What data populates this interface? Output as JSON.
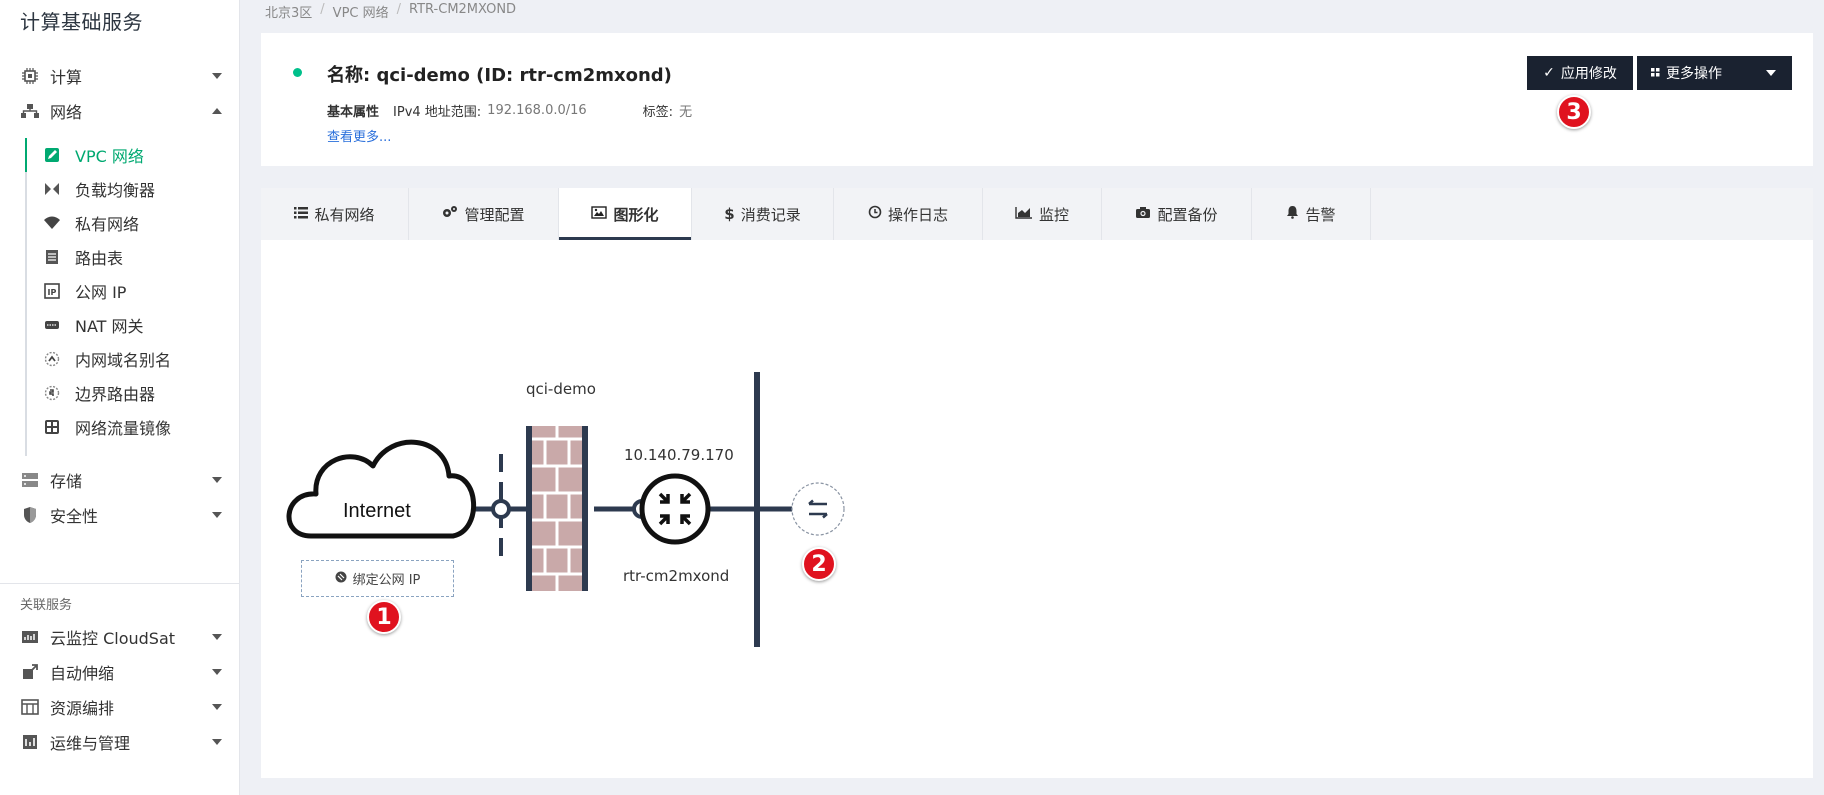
{
  "sidebar": {
    "title": "计算基础服务",
    "groups": [
      {
        "label": "计算",
        "icon": "chip-icon"
      },
      {
        "label": "网络",
        "icon": "network-icon"
      }
    ],
    "network_items": [
      {
        "label": "VPC 网络",
        "icon": "vpc-icon",
        "active": true
      },
      {
        "label": "负载均衡器",
        "icon": "load-balancer-icon"
      },
      {
        "label": "私有网络",
        "icon": "wifi-icon"
      },
      {
        "label": "路由表",
        "icon": "route-table-icon"
      },
      {
        "label": "公网 IP",
        "icon": "public-ip-icon"
      },
      {
        "label": "NAT 网关",
        "icon": "nat-gateway-icon"
      },
      {
        "label": "内网域名别名",
        "icon": "dns-alias-icon"
      },
      {
        "label": "边界路由器",
        "icon": "border-router-icon"
      },
      {
        "label": "网络流量镜像",
        "icon": "traffic-mirror-icon"
      }
    ],
    "other_groups": [
      {
        "label": "存储",
        "icon": "storage-icon"
      },
      {
        "label": "安全性",
        "icon": "shield-icon"
      }
    ],
    "related_title": "关联服务",
    "related": [
      {
        "label": "云监控 CloudSat",
        "icon": "monitor-icon"
      },
      {
        "label": "自动伸缩",
        "icon": "autoscale-icon"
      },
      {
        "label": "资源编排",
        "icon": "orchestration-icon"
      },
      {
        "label": "运维与管理",
        "icon": "ops-icon"
      }
    ]
  },
  "breadcrumb": [
    "北京3区",
    "VPC 网络",
    "RTR-CM2MXOND"
  ],
  "header": {
    "name": "名称: qci-demo (ID: rtr-cm2mxond)",
    "basic_label": "基本属性",
    "ipv4_label": "IPv4 地址范围:",
    "ipv4_value": "192.168.0.0/16",
    "tag_label": "标签:",
    "tag_value": "无",
    "more_link": "查看更多...",
    "apply_label": "应用修改",
    "more_ops_label": "更多操作",
    "status_color": "#00c08b"
  },
  "tabs": [
    {
      "label": "私有网络",
      "icon": "list-icon"
    },
    {
      "label": "管理配置",
      "icon": "cogs-icon"
    },
    {
      "label": "图形化",
      "icon": "image-icon",
      "active": true
    },
    {
      "label": "消费记录",
      "icon": "dollar-icon"
    },
    {
      "label": "操作日志",
      "icon": "clock-icon"
    },
    {
      "label": "监控",
      "icon": "area-chart-icon"
    },
    {
      "label": "配置备份",
      "icon": "camera-icon"
    },
    {
      "label": "告警",
      "icon": "bell-icon"
    }
  ],
  "diagram": {
    "internet_label": "Internet",
    "firewall_name": "qci-demo",
    "router_ip": "10.140.79.170",
    "router_id": "rtr-cm2mxond",
    "bind_ip_label": "绑定公网 IP"
  },
  "badges": [
    "1",
    "2",
    "3"
  ],
  "colors": {
    "accent": "#00a971",
    "dark_button": "#1a2230",
    "badge": "#e0121f",
    "firewall_brick": "#c9a9a9"
  }
}
